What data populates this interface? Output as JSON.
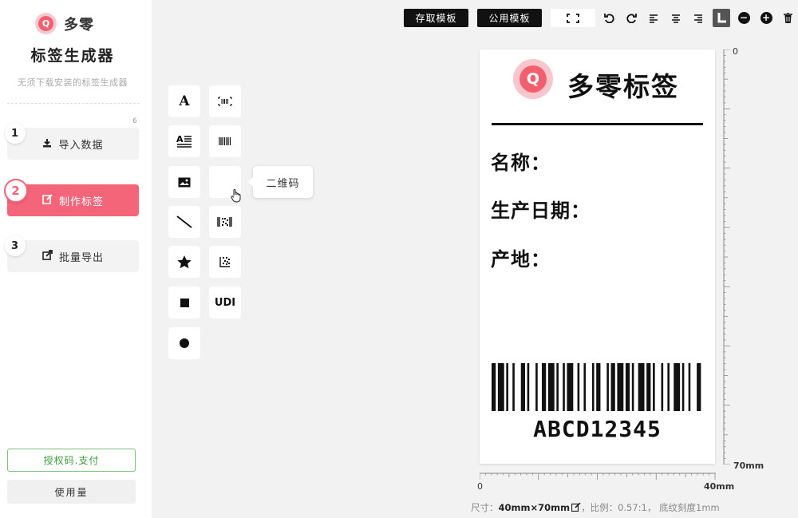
{
  "sidebar": {
    "logo_text": "多零",
    "logo_letter": "Q",
    "title": "标签生成器",
    "subtitle": "无须下载安装的标签生成器",
    "count": "6",
    "steps": [
      {
        "num": "1",
        "label": "导入数据",
        "icon": "download-icon"
      },
      {
        "num": "2",
        "label": "制作标签",
        "icon": "edit-icon"
      },
      {
        "num": "3",
        "label": "批量导出",
        "icon": "export-icon"
      }
    ],
    "license_label": "授权码.支付",
    "usage_label": "使用量"
  },
  "tools": {
    "text_glyph": "A",
    "udi_label": "UDI",
    "tooltip": "二维码"
  },
  "toolbar": {
    "save_template": "存取模板",
    "public_template": "公用模板"
  },
  "label": {
    "logo_letter": "Q",
    "title": "多零标签",
    "fields": [
      "名称：",
      "生产日期：",
      "产地："
    ],
    "barcode_text": "ABCD12345"
  },
  "ruler": {
    "v_start": "0",
    "v_end": "70mm",
    "h_start": "0",
    "h_end": "40mm"
  },
  "status": {
    "size_prefix": "尺寸：",
    "size_value": "40mm×70mm",
    "ratio_text": "，比例：0.57:1， 底纹刻度1mm"
  },
  "colors": {
    "accent": "#f4657a",
    "license_green": "#3a9a3a"
  }
}
